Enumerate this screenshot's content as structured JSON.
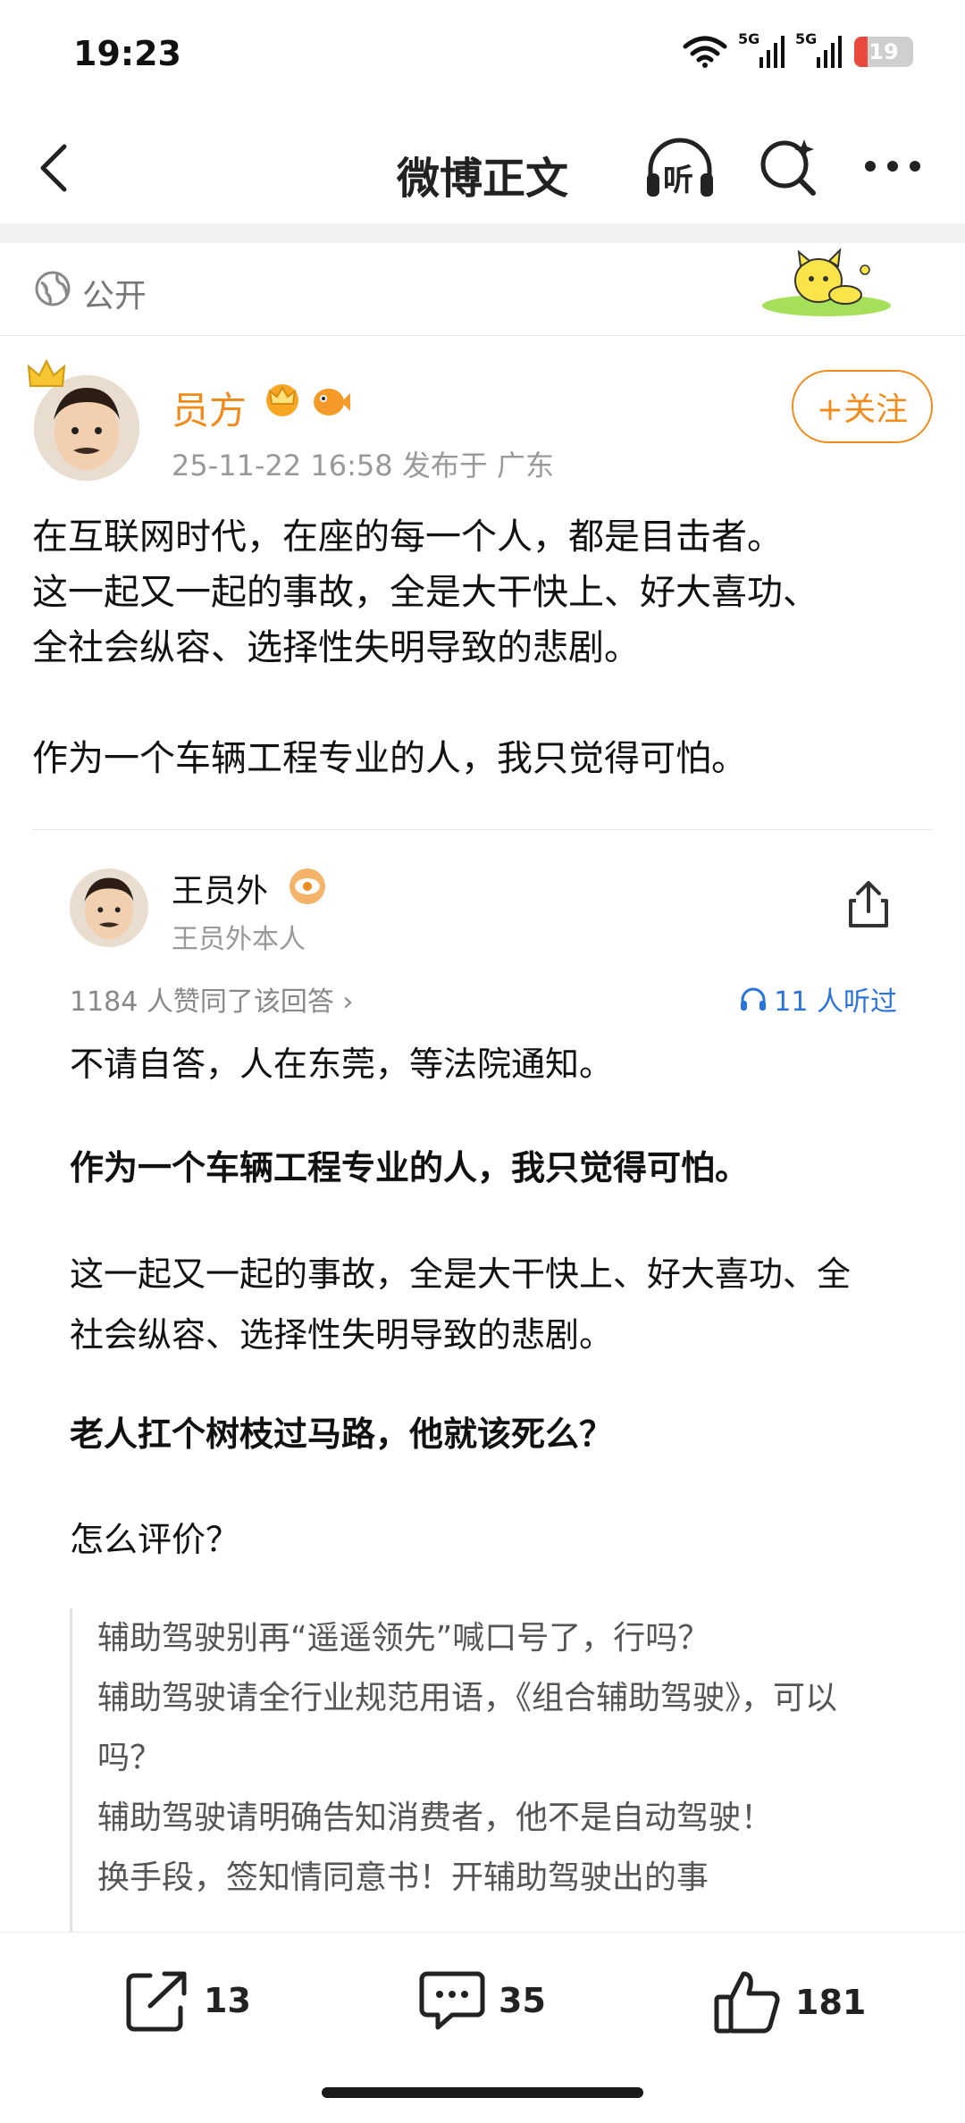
{
  "status": {
    "time": "19:23",
    "net1": "5G",
    "net2": "5G",
    "battery": "19",
    "battery_color": "#e84a3c"
  },
  "nav": {
    "title": "微博正文",
    "listen_label": "听"
  },
  "visibility": {
    "label": "公开"
  },
  "post": {
    "author": "员方",
    "meta": "25-11-22 16:58   发布于 广东",
    "follow_label": "+关注",
    "lines": [
      "在互联网时代，在座的每一个人，都是目击者。",
      "这一起又一起的事故，全是大干快上、好大喜功、",
      "全社会纵容、选择性失明导致的悲剧。",
      "作为一个车辆工程专业的人，我只觉得可怕。"
    ]
  },
  "answer": {
    "name": "王员外",
    "subtitle": "王员外本人",
    "likes": "1184 人赞同了该回答 ›",
    "listened": "11 人听过",
    "p1": "不请自答，人在东莞，等法院通知。",
    "p2_bold": "作为一个车辆工程专业的人，我只觉得可怕。",
    "p3": "这一起又一起的事故，全是大干快上、好大喜功、全社会纵容、选择性失明导致的悲剧。",
    "p4_bold": "老人扛个树枝过马路，他就该死么？",
    "p5": "怎么评价？",
    "quote": [
      "辅助驾驶别再“遥遥领先”喊口号了，行吗？",
      "辅助驾驶请全行业规范用语，《组合辅助驾驶》，可以吗？",
      "辅助驾驶请明确告知消费者，他不是自动驾驶！",
      "换手段，签知情同意书！开辅助驾驶出的事"
    ]
  },
  "bottom": {
    "reposts": "13",
    "comments": "35",
    "likes": "181"
  },
  "colors": {
    "accent": "#f08c1e",
    "link": "#2a73d9"
  }
}
